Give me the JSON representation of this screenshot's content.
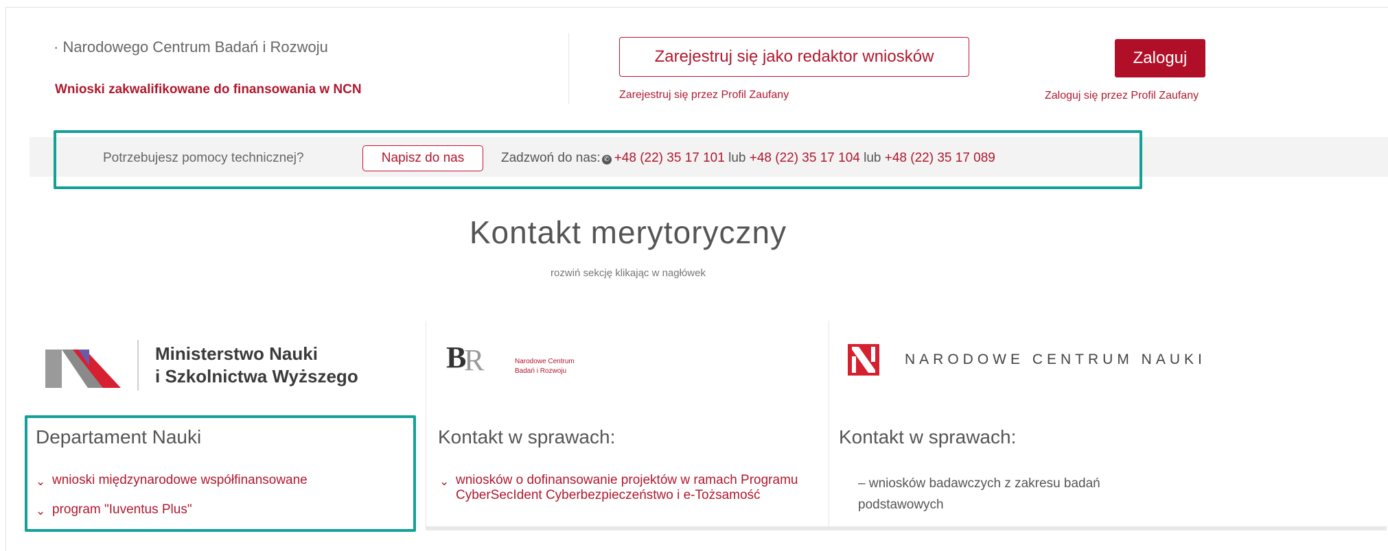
{
  "header": {
    "ncbr_link": "· Narodowego Centrum Badań i Rozwoju",
    "ncn_link": "Wnioski zakwalifikowane do finansowania w NCN",
    "register_button": "Zarejestruj się jako redaktor wniosków",
    "register_sub": "Zarejestruj się przez Profil Zaufany",
    "login_button": "Zaloguj",
    "login_sub": "Zaloguj się przez Profil Zaufany"
  },
  "help": {
    "question": "Potrzebujesz pomocy technicznej?",
    "write_button": "Napisz do nas",
    "call_label": "Zadzwoń do nas:",
    "phone1": "+48 (22) 35 17 101",
    "or1": "lub",
    "phone2": "+48 (22) 35 17 104",
    "or2": "lub",
    "phone3": "+48 (22) 35 17 089"
  },
  "main": {
    "title": "Kontakt merytoryczny",
    "subtitle": "rozwiń sekcję klikając w nagłówek"
  },
  "columns": [
    {
      "logo_lines": [
        "Ministerstwo Nauki",
        "i Szkolnictwa Wyższego"
      ],
      "heading": "Departament Nauki",
      "items": [
        "wnioski międzynarodowe współfinansowane",
        "program \"Iuventus Plus\""
      ]
    },
    {
      "logo_lines": [
        "Narodowe Centrum",
        "Badań i Rozwoju"
      ],
      "heading": "Kontakt w sprawach:",
      "items": [
        "wniosków o dofinansowanie projektów w ramach Programu CyberSecIdent Cyberbezpieczeństwo i e-Tożsamość"
      ]
    },
    {
      "logo_text": "Narodowe Centrum Nauki",
      "heading": "Kontakt w sprawach:",
      "items": [
        "– wniosków badawczych z zakresu badań podstawowych"
      ]
    }
  ],
  "colors": {
    "brand_red": "#b0182e",
    "highlight": "#13a097"
  }
}
